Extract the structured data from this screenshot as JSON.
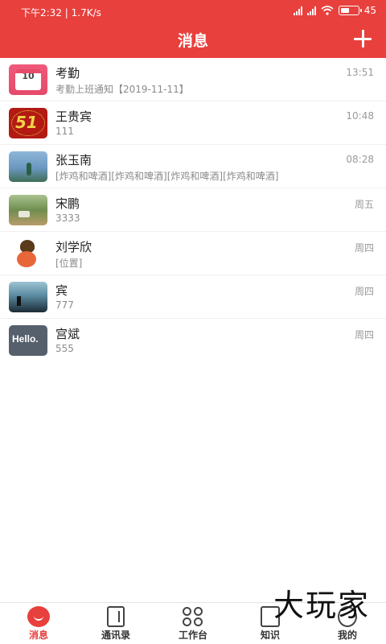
{
  "status_bar": {
    "left": "下午2:32 | 1.7K/s",
    "battery": "45"
  },
  "header": {
    "title": "消息"
  },
  "messages": [
    {
      "name": "考勤",
      "preview": "考勤上班通知【2019-11-11】",
      "time": "13:51",
      "avatar_text": "10"
    },
    {
      "name": "王贵宾",
      "preview": "111",
      "time": "10:48",
      "avatar_text": "51"
    },
    {
      "name": "张玉南",
      "preview": "[炸鸡和啤酒][炸鸡和啤酒][炸鸡和啤酒][炸鸡和啤酒]",
      "time": "08:28"
    },
    {
      "name": "宋鹏",
      "preview": "3333",
      "time": "周五"
    },
    {
      "name": "刘学欣",
      "preview": "[位置]",
      "time": "周四"
    },
    {
      "name": "宾",
      "preview": "777",
      "time": "周四"
    },
    {
      "name": "宫斌",
      "preview": "555",
      "time": "周四",
      "avatar_text": "Hello."
    }
  ],
  "bottom_nav": [
    {
      "label": "消息",
      "icon": "message-icon",
      "active": true
    },
    {
      "label": "通讯录",
      "icon": "contacts-icon",
      "active": false
    },
    {
      "label": "工作台",
      "icon": "workbench-icon",
      "active": false
    },
    {
      "label": "知识",
      "icon": "knowledge-icon",
      "active": false
    },
    {
      "label": "我的",
      "icon": "profile-icon",
      "active": false
    }
  ],
  "watermark": "大玩家",
  "colors": {
    "accent": "#e8403d",
    "text_primary": "#222222",
    "text_secondary": "#8b8b8b"
  }
}
